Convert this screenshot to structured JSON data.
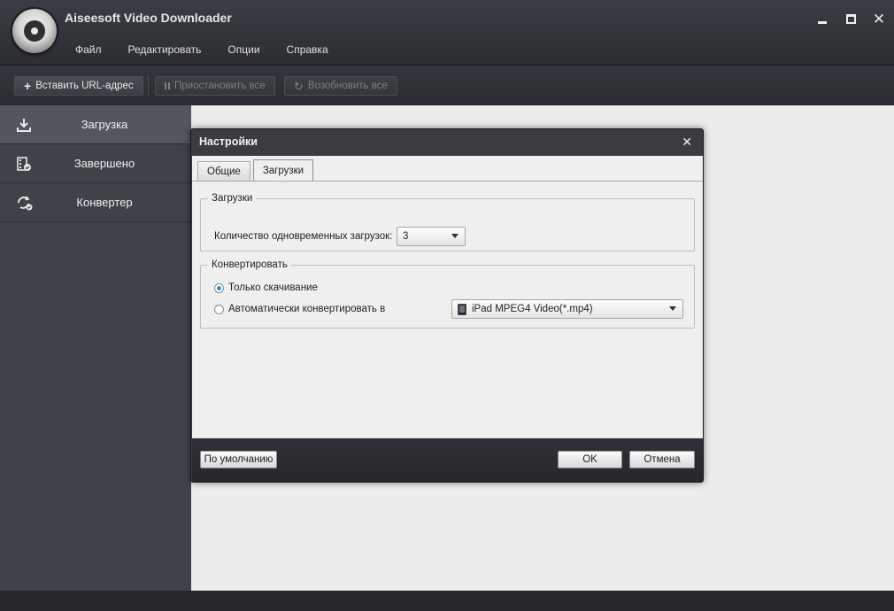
{
  "app": {
    "title": "Aiseesoft Video Downloader"
  },
  "menu": {
    "items": [
      {
        "label": "Файл"
      },
      {
        "label": "Редактировать"
      },
      {
        "label": "Опции"
      },
      {
        "label": "Справка"
      }
    ]
  },
  "toolbar": {
    "paste_url_label": "Вставить URL-адрес",
    "pause_all_label": "Приостановить все",
    "resume_all_label": "Возобновить все"
  },
  "sidebar": {
    "items": [
      {
        "label": "Загрузка",
        "icon": "download-icon",
        "active": true
      },
      {
        "label": "Завершено",
        "icon": "film-check-icon",
        "active": false
      },
      {
        "label": "Конвертер",
        "icon": "convert-icon",
        "active": false
      }
    ]
  },
  "dialog": {
    "title": "Настройки",
    "tabs": [
      {
        "label": "Общие",
        "active": false
      },
      {
        "label": "Загрузки",
        "active": true
      }
    ],
    "downloads_group": {
      "legend": "Загрузки",
      "count_label": "Количество одновременных загрузок:",
      "count_value": "3"
    },
    "convert_group": {
      "legend": "Конвертировать",
      "option_download_only": "Только скачивание",
      "option_auto_convert": "Автоматически конвертировать в",
      "selected_option": "download_only",
      "format_value": "iPad MPEG4 Video(*.mp4)"
    },
    "buttons": {
      "default_label": "По умолчанию",
      "ok_label": "OK",
      "cancel_label": "Отмена"
    }
  },
  "colors": {
    "chrome_dark": "#2b2d32",
    "sidebar": "#3f4248",
    "sidebar_active": "#53565d",
    "content_bg": "#ececec",
    "radio_accent": "#2e8fd6"
  }
}
